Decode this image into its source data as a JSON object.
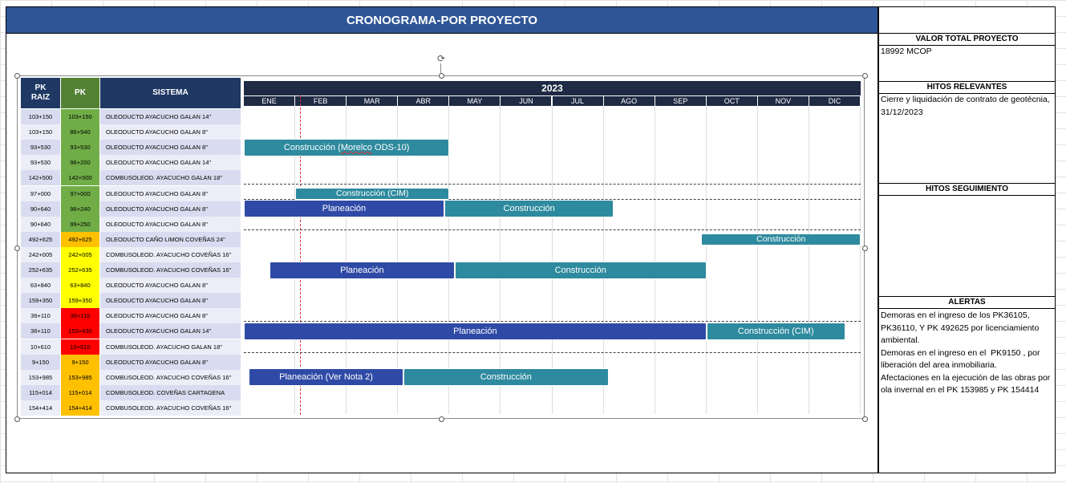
{
  "title": "CRONOGRAMA-POR PROYECTO",
  "side_panel": {
    "valor_header": "VALOR TOTAL PROYECTO",
    "valor_value": "18992  MCOP",
    "hitos_header": "HITOS RELEVANTES",
    "hitos_text": "Cierre y liquidación de contrato de geotécnia, 31/12/2023",
    "seguimiento_header": "HITOS SEGUIMIENTO",
    "seguimiento_text": "",
    "alertas_header": "ALERTAS",
    "alertas_text": "Demoras en el ingreso de los PK36105, PK36110, Y PK 492625 por licenciamiento ambiental.\nDemoras en el ingreso en el  PK9150 , por liberación del area inmobiliaria.\nAfectaciones en la ejecución de las obras por ola invernal en el PK 153985 y PK 154414"
  },
  "table": {
    "headers": {
      "pk_raiz": "PK RAIZ",
      "pk": "PK",
      "sistema": "SISTEMA"
    },
    "rows": [
      {
        "raiz": "103+150",
        "pk": "103+150",
        "sistema": "OLEODUCTO AYACUCHO GALAN 14\"",
        "status": "green"
      },
      {
        "raiz": "103+150",
        "pk": "86+540",
        "sistema": "OLEODUCTO AYACUCHO GALAN 8\"",
        "status": "green"
      },
      {
        "raiz": "93+530",
        "pk": "93+530",
        "sistema": "OLEODUCTO AYACUCHO GALAN 8\"",
        "status": "green"
      },
      {
        "raiz": "93+530",
        "pk": "96+200",
        "sistema": "OLEODUCTO AYACUCHO GALAN 14\"",
        "status": "green"
      },
      {
        "raiz": "142+500",
        "pk": "142+500",
        "sistema": "COMBUSOLEOD. AYACUCHO GALAN 18\"",
        "status": "green"
      },
      {
        "raiz": "97+000",
        "pk": "97+000",
        "sistema": "OLEODUCTO AYACUCHO GALAN 8\"",
        "status": "green"
      },
      {
        "raiz": "90+640",
        "pk": "96+240",
        "sistema": "OLEODUCTO AYACUCHO GALAN 8\"",
        "status": "green"
      },
      {
        "raiz": "90+640",
        "pk": "99+250",
        "sistema": "OLEODUCTO AYACUCHO GALAN 8\"",
        "status": "green"
      },
      {
        "raiz": "492+625",
        "pk": "492+625",
        "sistema": "OLEODUCTO CAÑO LIMON COVEÑAS 24\"",
        "status": "orange"
      },
      {
        "raiz": "242+005",
        "pk": "242+005",
        "sistema": "COMBUSOLEOD. AYACUCHO COVEÑAS 16\"",
        "status": "yellow"
      },
      {
        "raiz": "252+635",
        "pk": "252+635",
        "sistema": "COMBUSOLEOD. AYACUCHO COVEÑAS 16\"",
        "status": "yellow"
      },
      {
        "raiz": "63+840",
        "pk": "63+840",
        "sistema": "OLEODUCTO AYACUCHO GALAN 8\"",
        "status": "yellow"
      },
      {
        "raiz": "159+350",
        "pk": "159+350",
        "sistema": "OLEODUCTO AYACUCHO GALAN 8\"",
        "status": "yellow"
      },
      {
        "raiz": "36+110",
        "pk": "36+110",
        "sistema": "OLEODUCTO AYACUCHO GALAN 8\"",
        "status": "red"
      },
      {
        "raiz": "36+110",
        "pk": "153+830",
        "sistema": "OLEODUCTO AYACUCHO GALAN 14\"",
        "status": "red"
      },
      {
        "raiz": "10+610",
        "pk": "10+610",
        "sistema": "COMBUSOLEOD. AYACUCHO GALAN 18\"",
        "status": "red"
      },
      {
        "raiz": "9+150",
        "pk": "9+150",
        "sistema": "OLEODUCTO AYACUCHO GALAN 8\"",
        "status": "orange"
      },
      {
        "raiz": "153+985",
        "pk": "153+985",
        "sistema": "COMBUSOLEOD. AYACUCHO COVEÑAS 16\"",
        "status": "orange"
      },
      {
        "raiz": "115+014",
        "pk": "115+014",
        "sistema": "COMBUSOLEOD. COVEÑAS CARTAGENA",
        "status": "orange"
      },
      {
        "raiz": "154+414",
        "pk": "154+414",
        "sistema": "COMBUSOLEOD. AYACUCHO COVEÑAS 16\"",
        "status": "orange"
      }
    ]
  },
  "status_colors": {
    "green": "#70ad47",
    "yellow": "#ffff00",
    "orange": "#ffc000",
    "red": "#ff0000"
  },
  "gantt": {
    "year": "2023",
    "months": [
      "ENE",
      "FEB",
      "MAR",
      "ABR",
      "MAY",
      "JUN",
      "JUL",
      "AGO",
      "SEP",
      "OCT",
      "NOV",
      "DIC"
    ],
    "today_month": 1.1,
    "bars": [
      {
        "label": "Construcción (Morelco ODS-10)",
        "start": 0.0,
        "end": 4.0,
        "row": 2,
        "kind": "teal",
        "size": "normal",
        "squig": "Morelco"
      },
      {
        "label": "Construcción (CIM)",
        "start": 1.0,
        "end": 4.0,
        "row": 5,
        "kind": "teal",
        "size": "small"
      },
      {
        "label": "Planeación",
        "start": 0.0,
        "end": 3.9,
        "row": 6,
        "kind": "blue",
        "size": "normal"
      },
      {
        "label": "Construcción",
        "start": 3.9,
        "end": 7.2,
        "row": 6,
        "kind": "teal",
        "size": "normal"
      },
      {
        "label": "Construcción",
        "start": 8.9,
        "end": 12.0,
        "row": 8,
        "kind": "teal",
        "size": "small"
      },
      {
        "label": "Planeación",
        "start": 0.5,
        "end": 4.1,
        "row": 10,
        "kind": "blue",
        "size": "normal"
      },
      {
        "label": "Construcción",
        "start": 4.1,
        "end": 9.0,
        "row": 10,
        "kind": "teal",
        "size": "normal"
      },
      {
        "label": "Planeación",
        "start": 0.0,
        "end": 9.0,
        "row": 14,
        "kind": "blue",
        "size": "normal"
      },
      {
        "label": "Construcción (CIM)",
        "start": 9.0,
        "end": 11.7,
        "row": 14,
        "kind": "teal",
        "size": "normal"
      },
      {
        "label": "Planeación (Ver Nota 2)",
        "start": 0.1,
        "end": 3.1,
        "row": 17,
        "kind": "blue",
        "size": "normal"
      },
      {
        "label": "Construcción",
        "start": 3.1,
        "end": 7.1,
        "row": 17,
        "kind": "teal",
        "size": "normal"
      }
    ],
    "dashed_after_rows": [
      4,
      5,
      7,
      13,
      15
    ]
  }
}
